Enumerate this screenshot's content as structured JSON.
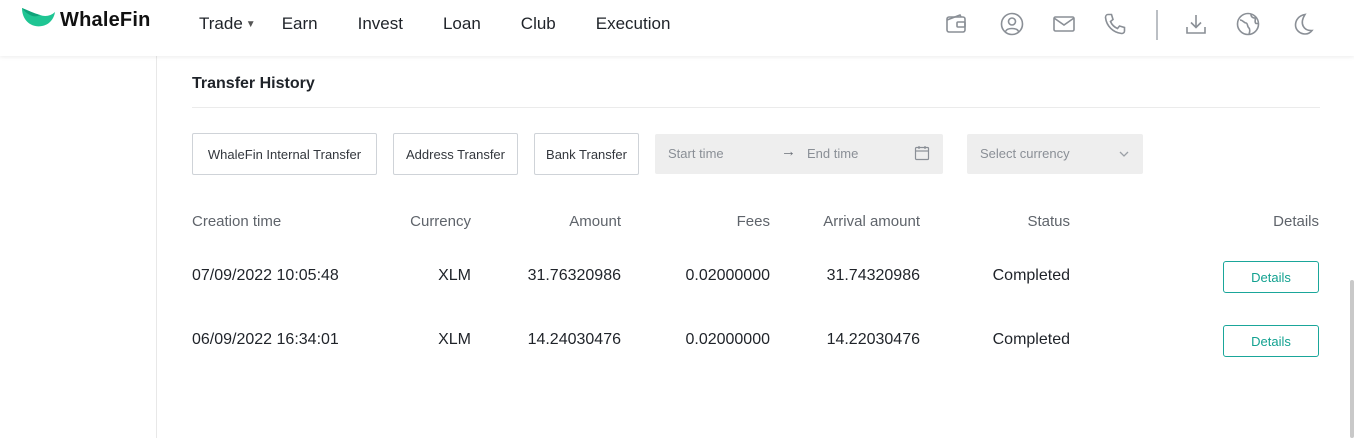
{
  "header": {
    "brand": "WhaleFin",
    "nav": [
      {
        "label": "Trade",
        "has_dropdown": true
      },
      {
        "label": "Earn"
      },
      {
        "label": "Invest"
      },
      {
        "label": "Loan"
      },
      {
        "label": "Club"
      },
      {
        "label": "Execution"
      }
    ],
    "tools": [
      "wallet-icon",
      "user-icon",
      "mail-icon",
      "phone-icon",
      "download-icon",
      "language-icon",
      "moon-icon"
    ]
  },
  "transfer_history": {
    "title": "Transfer History",
    "filters": {
      "tabs": [
        "WhaleFin Internal Transfer",
        "Address Transfer",
        "Bank Transfer"
      ],
      "start_placeholder": "Start time",
      "end_placeholder": "End time",
      "arrow": "→",
      "currency_placeholder": "Select currency"
    },
    "columns": [
      "Creation time",
      "Currency",
      "Amount",
      "Fees",
      "Arrival amount",
      "Status",
      "Details"
    ],
    "rows": [
      {
        "time": "07/09/2022 10:05:48",
        "currency": "XLM",
        "amount": "31.76320986",
        "fees": "0.02000000",
        "arrival": "31.74320986",
        "status": "Completed",
        "action": "Details"
      },
      {
        "time": "06/09/2022 16:34:01",
        "currency": "XLM",
        "amount": "14.24030476",
        "fees": "0.02000000",
        "arrival": "14.22030476",
        "status": "Completed",
        "action": "Details"
      }
    ]
  },
  "colors": {
    "accent": "#12a190",
    "brand_green": "#1fc593",
    "input_bg": "#eeeeee"
  }
}
